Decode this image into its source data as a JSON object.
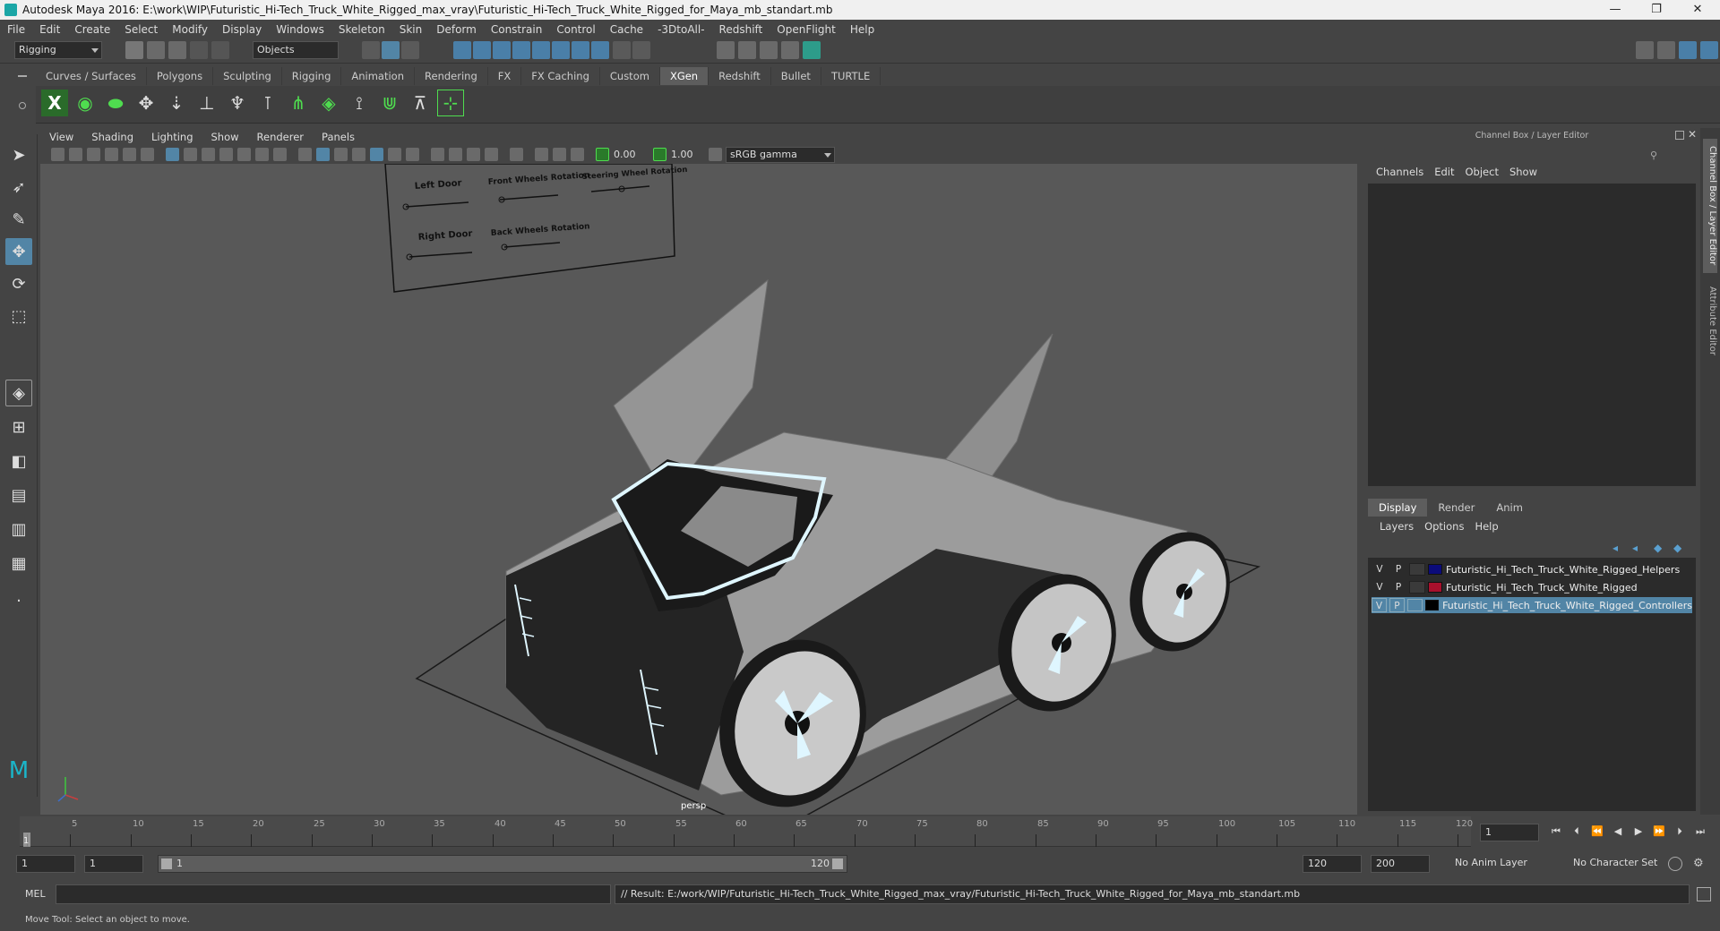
{
  "window": {
    "title": "Autodesk Maya 2016: E:\\work\\WIP\\Futuristic_Hi-Tech_Truck_White_Rigged_max_vray\\Futuristic_Hi-Tech_Truck_White_Rigged_for_Maya_mb_standart.mb",
    "min": "—",
    "restore": "❐",
    "close": "✕"
  },
  "menubar": [
    "File",
    "Edit",
    "Create",
    "Select",
    "Modify",
    "Display",
    "Windows",
    "Skeleton",
    "Skin",
    "Deform",
    "Constrain",
    "Control",
    "Cache",
    "-3DtoAll-",
    "Redshift",
    "OpenFlight",
    "Help"
  ],
  "statusline": {
    "mode": "Rigging",
    "selection_mask": "Objects"
  },
  "shelf": {
    "tabs": [
      "Curves / Surfaces",
      "Polygons",
      "Sculpting",
      "Rigging",
      "Animation",
      "Rendering",
      "FX",
      "FX Caching",
      "Custom",
      "XGen",
      "Redshift",
      "Bullet",
      "TURTLE"
    ],
    "active": "XGen"
  },
  "viewport": {
    "menu": [
      "View",
      "Shading",
      "Lighting",
      "Show",
      "Renderer",
      "Panels"
    ],
    "exposure": "0.00",
    "gamma": "1.00",
    "color_space": "sRGB gamma",
    "camera_label": "persp",
    "controls_panel": {
      "left_door": "Left Door",
      "front_wheels": "Front Wheels Rotation",
      "steering": "Steering Wheel Rotation",
      "right_door": "Right Door",
      "back_wheels": "Back Wheels Rotation"
    },
    "colors": {
      "background": "#585858",
      "body": "#9a9a9a",
      "dark": "#1e1e1e",
      "glow": "#dff6ff"
    }
  },
  "channel_box": {
    "title": "Channel Box / Layer Editor",
    "menu": [
      "Channels",
      "Edit",
      "Object",
      "Show"
    ]
  },
  "layer_editor": {
    "tabs": [
      "Display",
      "Render",
      "Anim"
    ],
    "active_tab": "Display",
    "menu": [
      "Layers",
      "Options",
      "Help"
    ],
    "layers": [
      {
        "v": "V",
        "p": "P",
        "color": "#0b0b7a",
        "name": "Futuristic_Hi_Tech_Truck_White_Rigged_Helpers",
        "selected": false
      },
      {
        "v": "V",
        "p": "P",
        "color": "#a8102c",
        "name": "Futuristic_Hi_Tech_Truck_White_Rigged",
        "selected": false
      },
      {
        "v": "V",
        "p": "P",
        "color": "#000000",
        "name": "Futuristic_Hi_Tech_Truck_White_Rigged_Controllers",
        "selected": true
      }
    ]
  },
  "side_tabs": [
    "Channel Box / Layer Editor",
    "Attribute Editor"
  ],
  "timeline": {
    "start": 1,
    "end": 120,
    "current": 1,
    "tick_labels": [
      "1",
      "5",
      "10",
      "15",
      "20",
      "25",
      "30",
      "35",
      "40",
      "45",
      "50",
      "55",
      "60",
      "65",
      "70",
      "75",
      "80",
      "85",
      "90",
      "95",
      "100",
      "105",
      "110",
      "115",
      "120"
    ],
    "current_frame_field": "1"
  },
  "range": {
    "start_field": "1",
    "playback_start": "1",
    "slider_start": "1",
    "slider_end": "120",
    "playback_end": "120",
    "end_field": "200",
    "anim_layer": "No Anim Layer",
    "char_set": "No Character Set"
  },
  "command": {
    "lang": "MEL",
    "result": "// Result: E:/work/WIP/Futuristic_Hi-Tech_Truck_White_Rigged_max_vray/Futuristic_Hi-Tech_Truck_White_Rigged_for_Maya_mb_standart.mb"
  },
  "help_line": "Move Tool: Select an object to move."
}
